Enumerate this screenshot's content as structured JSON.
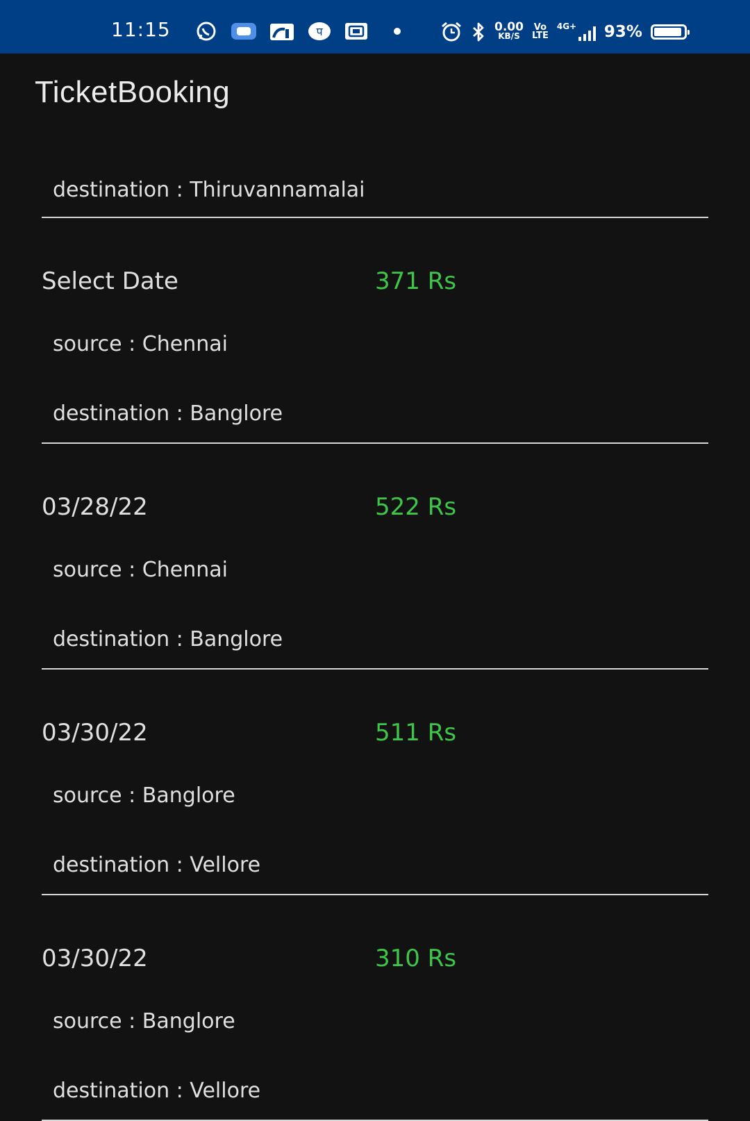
{
  "status_bar": {
    "time": "11:15",
    "notification_icons": [
      "whatsapp-icon",
      "chat-icon",
      "shop-icon",
      "bank-icon",
      "app-icon",
      "dot-icon"
    ],
    "alarm_icon": "alarm-icon",
    "bluetooth_icon": "bluetooth-icon",
    "net_speed_value": "0.00",
    "net_speed_unit": "KB/S",
    "volte_top": "Vo",
    "volte_bottom": "LTE",
    "network_type": "4G+",
    "battery_percent": "93%",
    "battery_level": 0.93
  },
  "app_bar": {
    "title": "TicketBooking"
  },
  "partial_ticket": {
    "destination": "destination : Thiruvannamalai"
  },
  "tickets": [
    {
      "date": "Select Date",
      "price": "371 Rs",
      "source": "source : Chennai",
      "destination": "destination : Banglore"
    },
    {
      "date": "03/28/22",
      "price": "522 Rs",
      "source": "source : Chennai",
      "destination": "destination : Banglore"
    },
    {
      "date": "03/30/22",
      "price": "511 Rs",
      "source": "source : Banglore",
      "destination": "destination : Vellore"
    },
    {
      "date": "03/30/22",
      "price": "310 Rs",
      "source": "source : Banglore",
      "destination": "destination : Vellore"
    }
  ],
  "colors": {
    "status_bar": "#003e86",
    "background": "#121212",
    "price": "#3dc648",
    "divider": "#d9d9d9"
  }
}
